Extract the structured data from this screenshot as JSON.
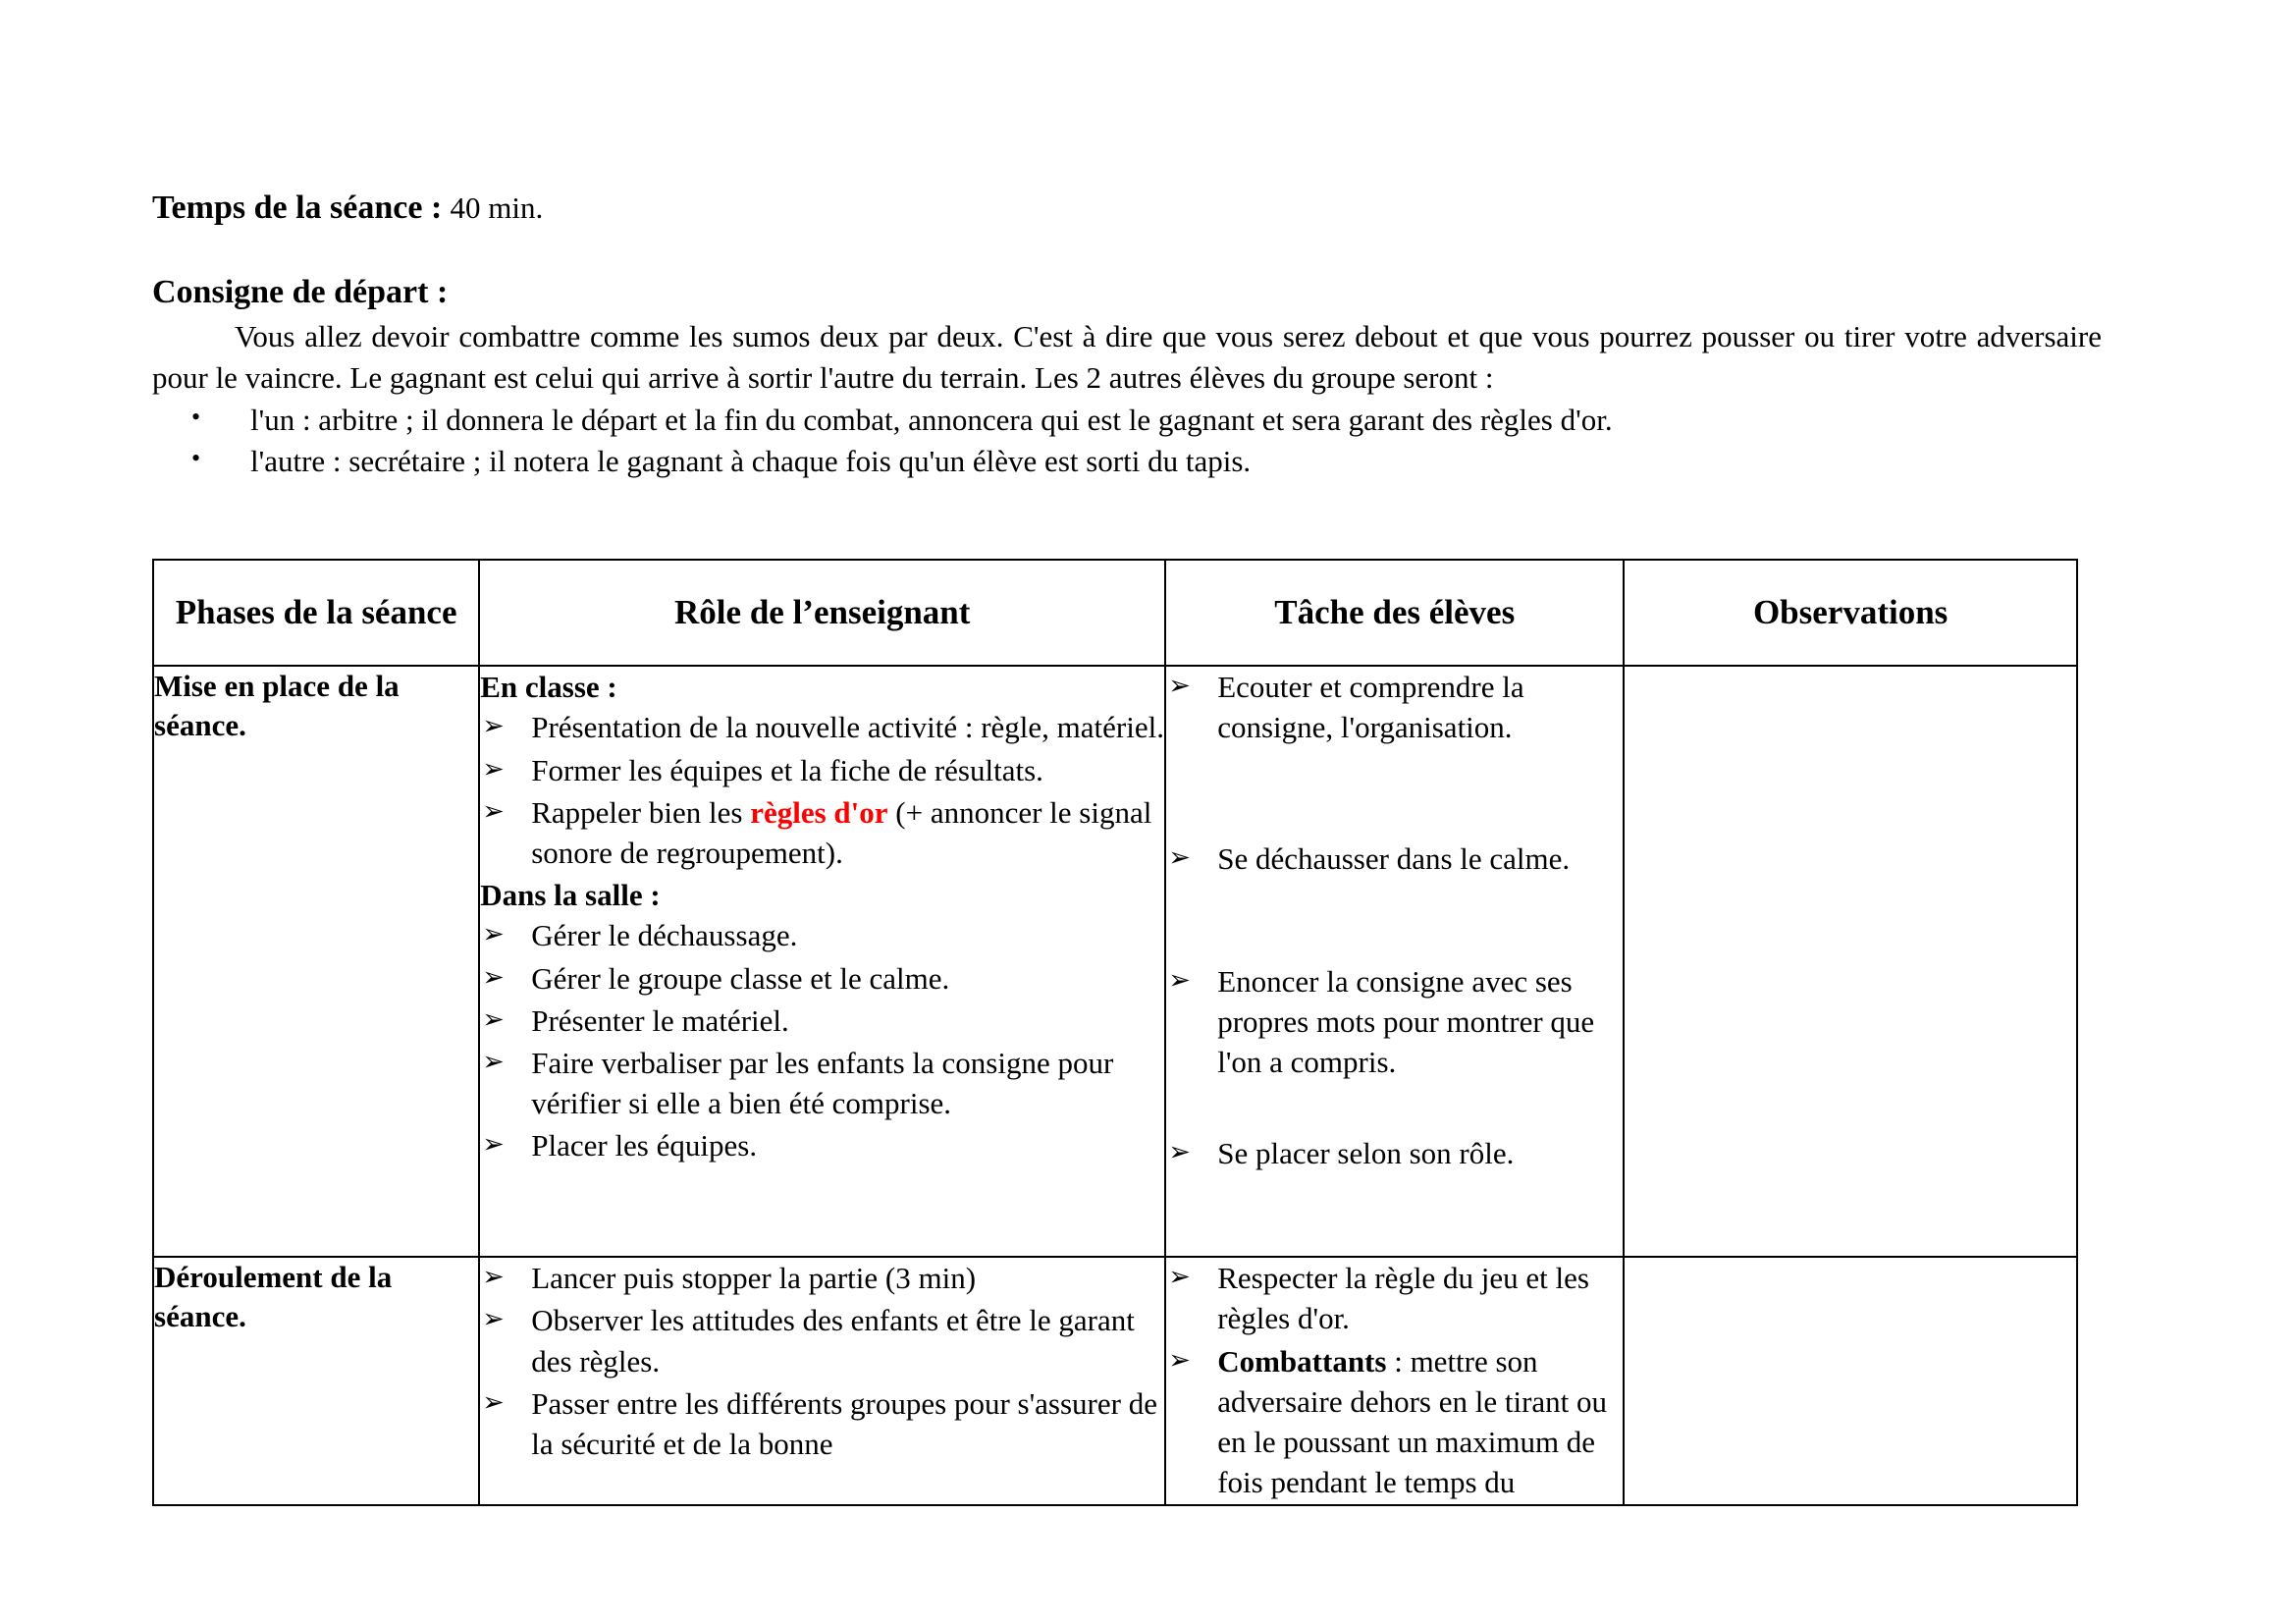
{
  "document": {
    "time_label": "Temps de la séance :",
    "time_value": "40 min.",
    "consigne_heading": "Consigne de départ :",
    "consigne_paragraph": "Vous allez devoir combattre comme les sumos deux par deux. C'est à dire que vous serez debout et que vous pourrez pousser ou tirer votre adversaire pour le vaincre. Le gagnant est celui qui arrive à sortir l'autre du terrain. Les 2 autres élèves du groupe seront :",
    "consigne_bullets": [
      "l'un : arbitre ; il donnera le départ et la fin du combat, annoncera qui est le gagnant et sera garant des règles d'or.",
      "l'autre : secrétaire ; il notera le gagnant à chaque fois qu'un élève est sorti du tapis."
    ]
  },
  "table": {
    "headers": [
      "Phases de la séance",
      "Rôle de l’enseignant",
      "Tâche des élèves",
      "Observations"
    ],
    "rows": [
      {
        "phase": "Mise en place de la séance.",
        "role": {
          "subhead_1": "En classe :",
          "items_1": [
            "Présentation de la nouvelle activité : règle, matériel.",
            "Former les équipes et la fiche de résultats."
          ],
          "item_rappeler_prefix": "Rappeler bien les ",
          "item_rappeler_highlight": "règles d'or",
          "item_rappeler_suffix": " (+ annoncer le signal sonore de regroupement).",
          "subhead_2": "Dans la salle :",
          "items_2": [
            "Gérer le déchaussage.",
            "Gérer le groupe classe et le calme.",
            "Présenter le matériel.",
            "Faire verbaliser par les enfants la consigne pour vérifier si elle a bien été comprise.",
            "Placer les équipes."
          ]
        },
        "tache": [
          "Ecouter et comprendre la consigne, l'organisation.",
          "Se déchausser dans le calme.",
          "Enoncer la consigne avec ses propres mots pour montrer que l'on a compris.",
          "Se placer selon son rôle."
        ],
        "observations": ""
      },
      {
        "phase": "Déroulement de la séance.",
        "role_items": [
          "Lancer puis stopper la partie (3 min)",
          "Observer les attitudes des enfants et être le garant des règles.",
          "Passer entre les différents groupes pour s'assurer de la sécurité et de la bonne"
        ],
        "tache_item_1": "Respecter la règle du jeu et les règles d'or.",
        "tache_item_2_bold": "Combattants",
        "tache_item_2_rest": " : mettre son adversaire dehors en le tirant ou en le poussant un maximum de fois pendant le temps du",
        "observations": ""
      }
    ]
  },
  "colors": {
    "highlight": "#ff0000",
    "text": "#000000",
    "border": "#000000",
    "background": "#ffffff"
  }
}
